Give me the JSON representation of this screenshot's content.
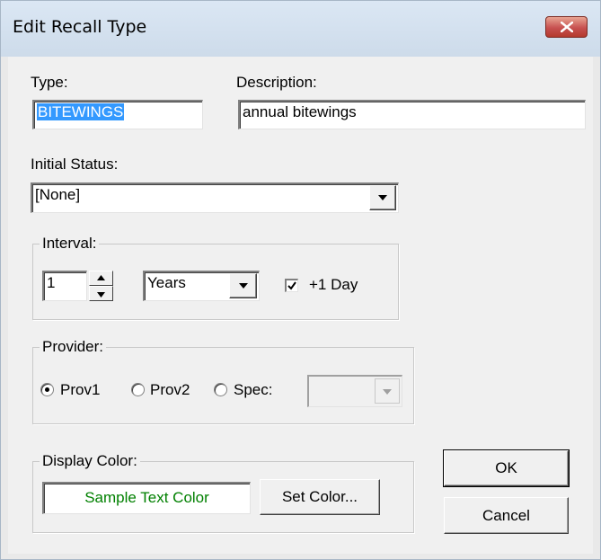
{
  "window": {
    "title": "Edit Recall Type",
    "close_icon": "close-icon"
  },
  "type": {
    "label": "Type:",
    "value": "BITEWINGS"
  },
  "description": {
    "label": "Description:",
    "value": "annual bitewings"
  },
  "initial_status": {
    "label": "Initial Status:",
    "selected": "[None]"
  },
  "interval": {
    "legend": "Interval:",
    "count": "1",
    "unit": "Years",
    "plus_one_day_label": "+1 Day",
    "plus_one_day_checked": true
  },
  "provider": {
    "legend": "Provider:",
    "options": [
      "Prov1",
      "Prov2",
      "Spec:"
    ],
    "selected": "Prov1",
    "spec_value": ""
  },
  "display_color": {
    "legend": "Display Color:",
    "sample_text": "Sample Text Color",
    "sample_color": "#008000",
    "set_color_label": "Set Color..."
  },
  "buttons": {
    "ok": "OK",
    "cancel": "Cancel"
  },
  "colors": {
    "selection": "#3399ff",
    "close_button": "#c75050",
    "title_bar": "#dbe7f4"
  }
}
